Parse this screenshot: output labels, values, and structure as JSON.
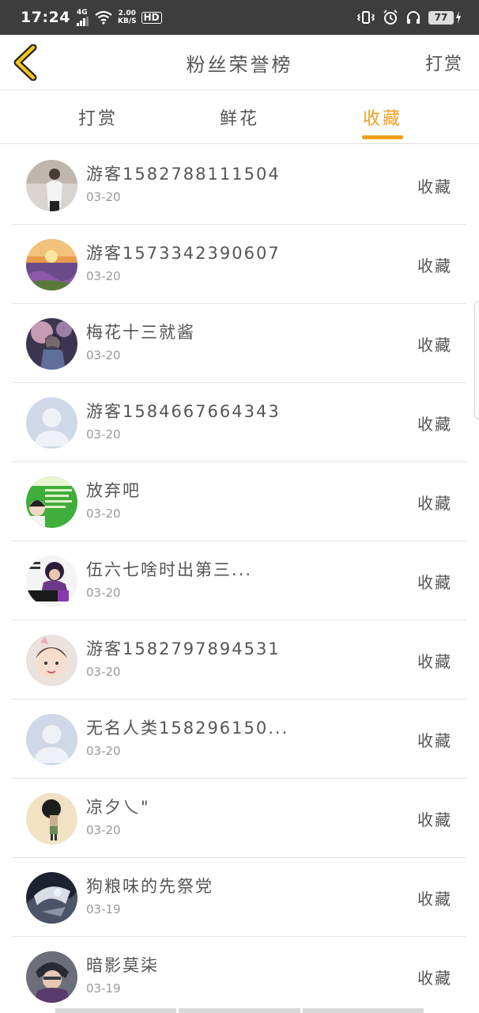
{
  "status_bar": {
    "time": "17:24",
    "network": "4G",
    "speed_value": "2.00",
    "speed_unit": "KB/S",
    "hd": "HD",
    "battery": "77"
  },
  "header": {
    "title": "粉丝荣誉榜",
    "action_label": "打赏"
  },
  "tabs": [
    {
      "label": "打赏",
      "active": false
    },
    {
      "label": "鲜花",
      "active": false
    },
    {
      "label": "收藏",
      "active": true
    }
  ],
  "colors": {
    "accent": "#f0a020",
    "status_bar_bg": "#3d3d3d"
  },
  "list": [
    {
      "name": "游客1582788111504",
      "date": "03-20",
      "action": "收藏",
      "avatar": "person-photo"
    },
    {
      "name": "游客1573342390607",
      "date": "03-20",
      "action": "收藏",
      "avatar": "flower-field"
    },
    {
      "name": "梅花十三就酱",
      "date": "03-20",
      "action": "收藏",
      "avatar": "anime-girl"
    },
    {
      "name": "游客1584667664343",
      "date": "03-20",
      "action": "收藏",
      "avatar": "default-user"
    },
    {
      "name": "放弃吧",
      "date": "03-20",
      "action": "收藏",
      "avatar": "green-poster"
    },
    {
      "name": "伍六七啥时出第三...",
      "date": "03-20",
      "action": "收藏",
      "avatar": "anime-character"
    },
    {
      "name": "游客1582797894531",
      "date": "03-20",
      "action": "收藏",
      "avatar": "child-photo"
    },
    {
      "name": "无名人类158296150...",
      "date": "03-20",
      "action": "收藏",
      "avatar": "default-user"
    },
    {
      "name": "凉夕乀\"",
      "date": "03-20",
      "action": "收藏",
      "avatar": "cartoon-figure"
    },
    {
      "name": "狗粮味的先祭党",
      "date": "03-19",
      "action": "收藏",
      "avatar": "dark-art"
    },
    {
      "name": "暗影莫柒",
      "date": "03-19",
      "action": "收藏",
      "avatar": "anime-boy"
    }
  ]
}
